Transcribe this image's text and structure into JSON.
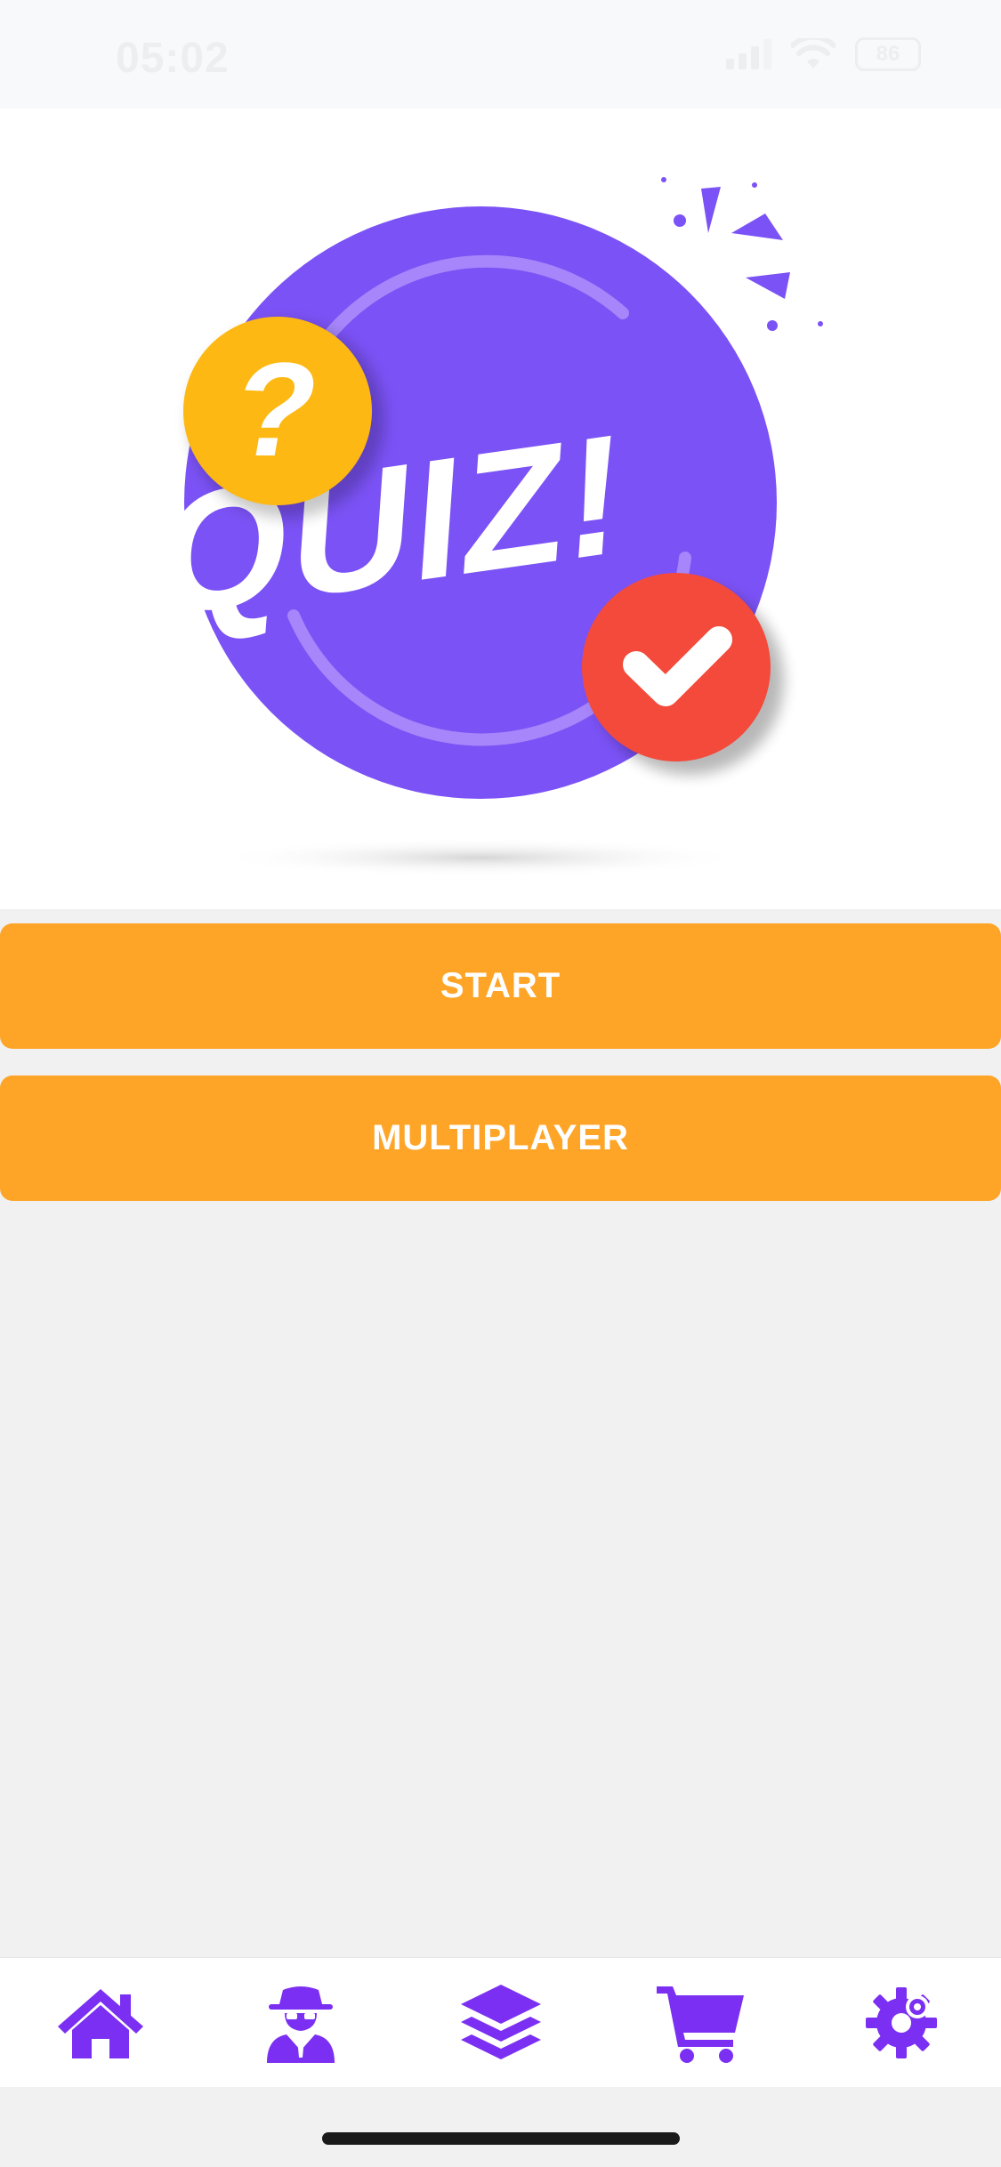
{
  "status_bar": {
    "time": "05:02",
    "battery": "86"
  },
  "hero": {
    "image_name": "quiz-logo",
    "title_text": "QUIZ!",
    "question_mark": "?",
    "colors": {
      "circle": "#7b52f5",
      "question": "#fdb813",
      "check": "#f34a3b"
    }
  },
  "buttons": {
    "start": "START",
    "multiplayer": "MULTIPLAYER"
  },
  "tabbar": {
    "accent": "#7b2ff2",
    "items": [
      {
        "icon": "home-icon"
      },
      {
        "icon": "spy-icon"
      },
      {
        "icon": "layers-icon"
      },
      {
        "icon": "cart-icon"
      },
      {
        "icon": "gear-icon"
      }
    ]
  }
}
